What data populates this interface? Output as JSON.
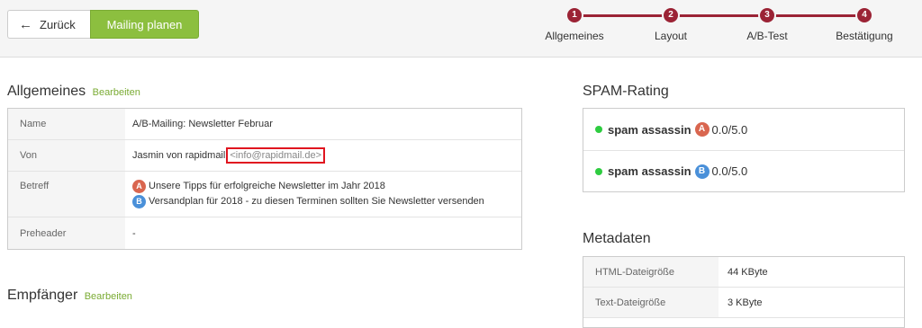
{
  "toolbar": {
    "back_label": "Zurück",
    "back_icon": "arrow-left-icon",
    "plan_label": "Mailing planen",
    "accent_color": "#8cbf3f"
  },
  "steps": [
    {
      "num": "1",
      "label": "Allgemeines"
    },
    {
      "num": "2",
      "label": "Layout"
    },
    {
      "num": "3",
      "label": "A/B-Test"
    },
    {
      "num": "4",
      "label": "Bestätigung"
    }
  ],
  "general": {
    "title": "Allgemeines",
    "edit_label": "Bearbeiten",
    "rows": {
      "name_key": "Name",
      "name_val": "A/B-Mailing: Newsletter Februar",
      "from_key": "Von",
      "from_name": "Jasmin von rapidmail",
      "from_email": "<info@rapidmail.de>",
      "subject_key": "Betreff",
      "subject_a_badge": "A",
      "subject_a": "Unsere Tipps für erfolgreiche Newsletter im Jahr 2018",
      "subject_b_badge": "B",
      "subject_b": "Versandplan für 2018 - zu diesen Terminen sollten Sie Newsletter versenden",
      "preheader_key": "Preheader",
      "preheader_val": "-"
    }
  },
  "recipients": {
    "title": "Empfänger",
    "edit_label": "Bearbeiten"
  },
  "spam": {
    "title": "SPAM-Rating",
    "rows": [
      {
        "name": "spam assassin",
        "badge": "A",
        "score": "0.0/5.0"
      },
      {
        "name": "spam assassin",
        "badge": "B",
        "score": "0.0/5.0"
      }
    ]
  },
  "meta": {
    "title": "Metadaten",
    "rows": [
      {
        "key": "HTML-Dateigröße",
        "val": "44 KByte"
      },
      {
        "key": "Text-Dateigröße",
        "val": "3 KByte"
      }
    ]
  }
}
